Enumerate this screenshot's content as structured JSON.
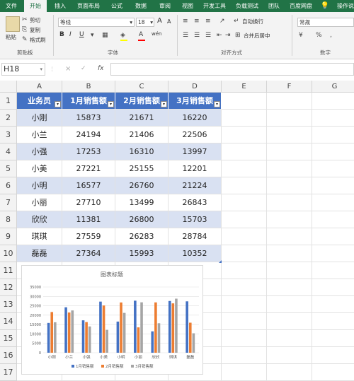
{
  "tabs": [
    "文件",
    "开始",
    "插入",
    "页面布局",
    "公式",
    "数据",
    "审阅",
    "视图",
    "开发工具",
    "负载测试",
    "团队",
    "百度网盘",
    "操作说"
  ],
  "ribbon": {
    "paste": "粘贴",
    "cut": "剪切",
    "copy": "复制",
    "format_painter": "格式刷",
    "clipboard": "剪贴板",
    "font_name": "等线",
    "font_size": "18",
    "bold": "B",
    "italic": "I",
    "underline": "U",
    "font_group": "字体",
    "wrap_text": "自动换行",
    "merge_center": "合并后居中",
    "alignment_group": "对齐方式",
    "number_format": "常规",
    "number_group": "数字",
    "increase_font": "A",
    "decrease_font": "A",
    "wen": "wén",
    "font_color_letter": "A"
  },
  "formula_bar": {
    "name_box": "H18",
    "cancel": "×",
    "confirm": "✓",
    "fx": "fx",
    "value": ""
  },
  "columns": [
    "A",
    "B",
    "C",
    "D",
    "E",
    "F",
    "G"
  ],
  "rows": [
    "1",
    "2",
    "3",
    "4",
    "5",
    "6",
    "7",
    "8",
    "9",
    "10",
    "11",
    "12",
    "13",
    "14",
    "15",
    "16",
    "17"
  ],
  "table": {
    "headers": [
      "业务员",
      "1月销售额",
      "2月销售额",
      "3月销售额"
    ],
    "rows": [
      [
        "小刚",
        "15873",
        "21671",
        "16220"
      ],
      [
        "小兰",
        "24194",
        "21406",
        "22506"
      ],
      [
        "小强",
        "17253",
        "16310",
        "13997"
      ],
      [
        "小美",
        "27221",
        "25155",
        "12201"
      ],
      [
        "小明",
        "16577",
        "26760",
        "21224"
      ],
      [
        "小丽",
        "27710",
        "13499",
        "26843"
      ],
      [
        "欣欣",
        "11381",
        "26800",
        "15703"
      ],
      [
        "琪琪",
        "27559",
        "26283",
        "28784"
      ],
      [
        "磊磊",
        "27364",
        "15993",
        "10352"
      ]
    ]
  },
  "chart_data": {
    "type": "bar",
    "title": "图表标题",
    "categories": [
      "小刚",
      "小兰",
      "小强",
      "小美",
      "小明",
      "小丽",
      "欣欣",
      "琪琪",
      "磊磊"
    ],
    "series": [
      {
        "name": "1月销售额",
        "color": "#4472c4",
        "values": [
          15873,
          24194,
          17253,
          27221,
          16577,
          27710,
          11381,
          27559,
          27364
        ]
      },
      {
        "name": "2月销售额",
        "color": "#ed7d31",
        "values": [
          21671,
          21406,
          16310,
          25155,
          26760,
          13499,
          26800,
          26283,
          15993
        ]
      },
      {
        "name": "3月销售额",
        "color": "#a5a5a5",
        "values": [
          16220,
          22506,
          13997,
          12201,
          21224,
          26843,
          15703,
          28784,
          10352
        ]
      }
    ],
    "ylim": [
      0,
      35000
    ],
    "yticks": [
      "0",
      "5000",
      "10000",
      "15000",
      "20000",
      "25000",
      "30000",
      "35000"
    ],
    "grid": true,
    "legend": "bottom"
  },
  "colors": {
    "accent": "#217346",
    "header_fill": "#4472c4",
    "band_fill": "#d9e1f2"
  }
}
